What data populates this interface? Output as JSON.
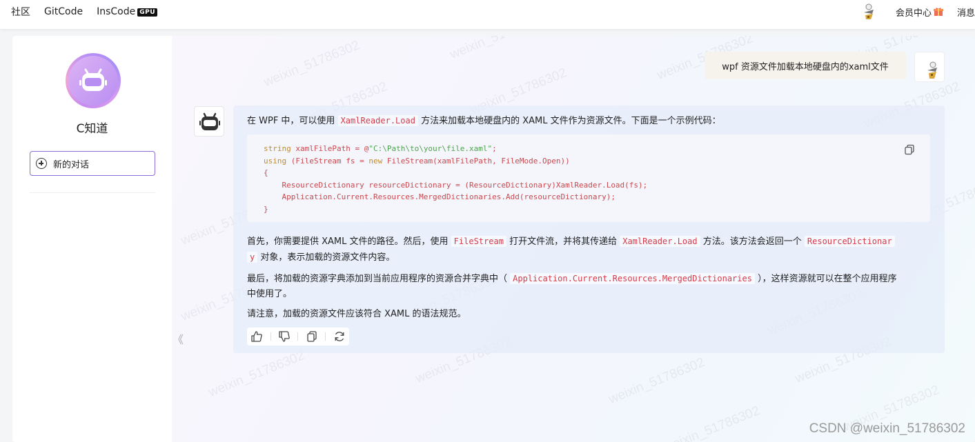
{
  "topbar": {
    "nav": [
      "社区",
      "GitCode",
      "InsCode"
    ],
    "gpu_badge": "GPU",
    "member_center": "会员中心",
    "messages": "消息"
  },
  "sidebar": {
    "brand": "C知道",
    "new_chat": "新的对话"
  },
  "chat": {
    "user_message": "wpf 资源文件加载本地硬盘内的xaml文件",
    "answer": {
      "intro_before": "在 WPF 中，可以使用",
      "intro_code": "XamlReader.Load",
      "intro_after": "方法来加载本地硬盘内的 XAML 文件作为资源文件。下面是一个示例代码：",
      "p2_a": "首先，你需要提供 XAML 文件的路径。然后，使用",
      "p2_code1": "FileStream",
      "p2_b": "打开文件流，并将其传递给",
      "p2_code2": "XamlReader.Load",
      "p2_c": "方法。该方法会返回一个",
      "p2_code3a": "ResourceDictionar",
      "p2_code3b": "y",
      "p2_d": "对象，表示加载的资源文件内容。",
      "p3_a": "最后，将加载的资源字典添加到当前应用程序的资源合并字典中（",
      "p3_code": "Application.Current.Resources.MergedDictionaries",
      "p3_b": "），这样资源就可以在整个应用程序",
      "p3_c": "中使用了。",
      "p4": "请注意，加载的资源文件应该符合 XAML 的语法规范。"
    },
    "code": {
      "l1_kw": "string",
      "l1_a": " xamlFilePath = @",
      "l1_str": "\"C:\\Path\\to\\your\\file.xaml\"",
      "l1_b": ";",
      "l2_kw": "using",
      "l2_a": " (FileStream fs = ",
      "l2_kw2": "new",
      "l2_b": " FileStream(xamlFilePath, FileMode.Open))",
      "l3": "{",
      "l4": "    ResourceDictionary resourceDictionary = (ResourceDictionary)XamlReader.Load(fs);",
      "l5": "    Application.Current.Resources.MergedDictionaries.Add(resourceDictionary);",
      "l6": "}"
    },
    "collapse_glyph": "《"
  },
  "watermark": {
    "text": "weixin_51786302",
    "csdn": "CSDN @weixin_51786302"
  }
}
